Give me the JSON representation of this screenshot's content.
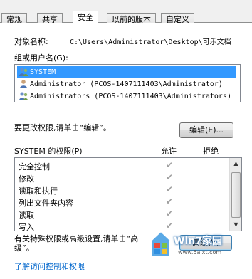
{
  "tabs": [
    {
      "label": "常规"
    },
    {
      "label": "共享"
    },
    {
      "label": "安全"
    },
    {
      "label": "以前的版本"
    },
    {
      "label": "自定义"
    }
  ],
  "object": {
    "label": "对象名称:",
    "value": "C:\\Users\\Administrator\\Desktop\\可乐文档"
  },
  "groups": {
    "label": "组或用户名(G):",
    "items": [
      {
        "name": "SYSTEM",
        "selected": true
      },
      {
        "name": "Administrator (PCOS-1407111403\\Administrator)",
        "selected": false
      },
      {
        "name": "Administrators (PCOS-1407111403\\Administrators)",
        "selected": false
      }
    ]
  },
  "edit": {
    "hint": "要更改权限,请单击“编辑”。",
    "button_label": "编辑(E)..."
  },
  "permissions": {
    "header": "SYSTEM 的权限(P)",
    "allow_label": "允许",
    "deny_label": "拒绝",
    "rows": [
      {
        "name": "完全控制",
        "allow": true,
        "deny": false
      },
      {
        "name": "修改",
        "allow": true,
        "deny": false
      },
      {
        "name": "读取和执行",
        "allow": true,
        "deny": false
      },
      {
        "name": "列出文件夹内容",
        "allow": true,
        "deny": false
      },
      {
        "name": "读取",
        "allow": true,
        "deny": false
      },
      {
        "name": "写入",
        "allow": true,
        "deny": false
      }
    ]
  },
  "advanced": {
    "hint_line1": "有关特殊权限或高级设置,请单击“高",
    "hint_line2": "级”。",
    "button_label": "高级(V)"
  },
  "link": {
    "label": "了解访问控制和权限"
  },
  "watermark": {
    "title": "Win7家园",
    "url": "www.5aixt.com"
  },
  "icons": {
    "user": "user-group-icon",
    "check": "checkmark-icon",
    "scroll_up": "chevron-up-icon",
    "scroll_down": "chevron-down-icon"
  }
}
